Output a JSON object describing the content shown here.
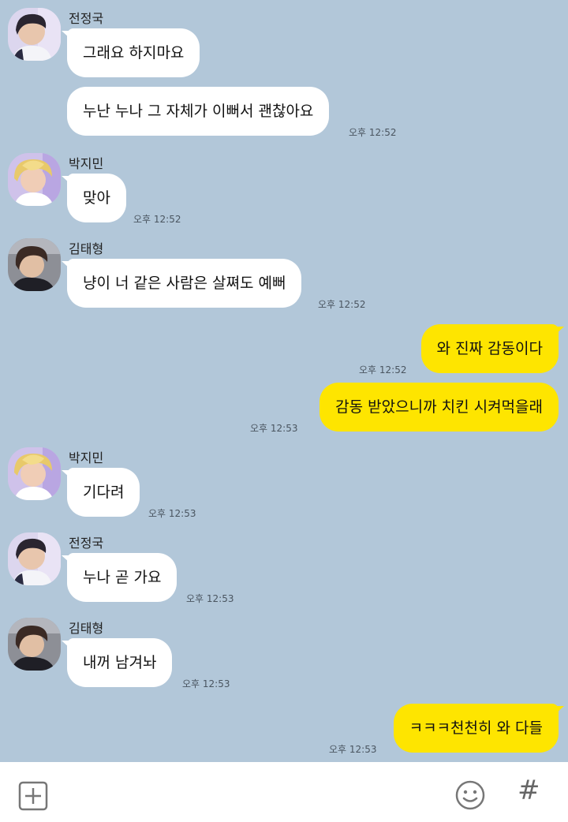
{
  "messages": [
    {
      "sender": "전정국",
      "text": "그래요 하지마요",
      "time": ""
    },
    {
      "sender": "전정국",
      "text": "누난 누나 그 자체가 이뻐서 괜찮아요",
      "time": "오후 12:52"
    },
    {
      "sender": "박지민",
      "text": "맞아",
      "time": "오후 12:52"
    },
    {
      "sender": "김태형",
      "text": "냥이 너 같은 사람은 살쪄도 예뻐",
      "time": "오후 12:52"
    },
    {
      "sender": "me",
      "text": "와 진짜 감동이다",
      "time": "오후 12:52"
    },
    {
      "sender": "me",
      "text": "감동 받았으니까 치킨 시켜먹을래",
      "time": "오후 12:53"
    },
    {
      "sender": "박지민",
      "text": "기다려",
      "time": "오후 12:53"
    },
    {
      "sender": "전정국",
      "text": "누나 곧 가요",
      "time": "오후 12:53"
    },
    {
      "sender": "김태형",
      "text": "내꺼 남겨놔",
      "time": "오후 12:53"
    },
    {
      "sender": "me",
      "text": "ㅋㅋㅋ천천히 와 다들",
      "time": "오후 12:53"
    }
  ],
  "input_bar": {
    "left_icon": "plus-square-icon",
    "emoji_icon": "smiley-icon",
    "hash_label": "#"
  },
  "colors": {
    "background": "#b2c7d9",
    "incoming_bubble": "#ffffff",
    "outgoing_bubble": "#fee500"
  }
}
